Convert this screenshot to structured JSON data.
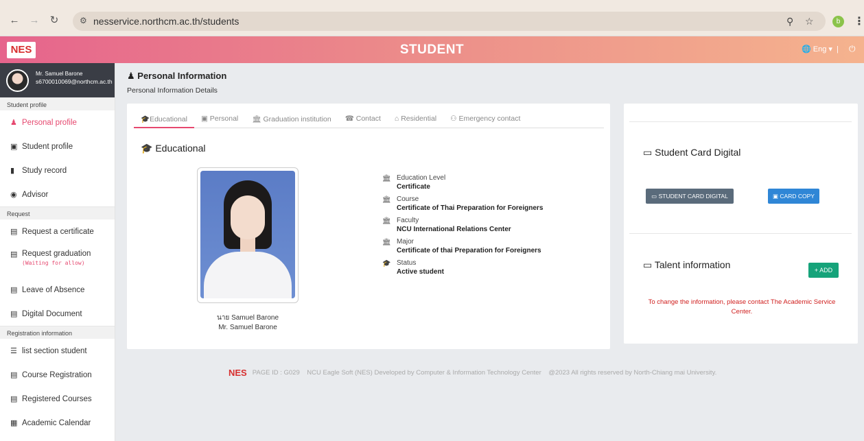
{
  "browser": {
    "url": "nesservice.northcm.ac.th/students",
    "profile_initial": "b"
  },
  "header": {
    "logo": "NES",
    "title": "STUDENT",
    "language": "Eng"
  },
  "user": {
    "name": "Mr. Samuel Barone",
    "email": "s6700010069@northcm.ac.th"
  },
  "sidebar": {
    "sections": [
      {
        "title": "Student profile",
        "items": [
          {
            "label": "Personal profile",
            "icon": "user-icon"
          },
          {
            "label": "Student profile",
            "icon": "id-card-icon"
          },
          {
            "label": "Study record",
            "icon": "bar-chart-icon"
          },
          {
            "label": "Advisor",
            "icon": "user-circle-icon"
          }
        ]
      },
      {
        "title": "Request",
        "items": [
          {
            "label": "Request a certificate",
            "icon": "file-icon"
          },
          {
            "label": "Request graduation",
            "note": "(Waiting for allow)",
            "icon": "file-icon"
          },
          {
            "label": "Leave of Absence",
            "icon": "file-icon"
          },
          {
            "label": "Digital Document",
            "icon": "file-icon"
          }
        ]
      },
      {
        "title": "Registration information",
        "items": [
          {
            "label": "list section student",
            "icon": "list-icon"
          },
          {
            "label": "Course Registration",
            "icon": "file-icon"
          },
          {
            "label": "Registered Courses",
            "icon": "file-icon"
          },
          {
            "label": "Academic Calendar",
            "icon": "calendar-icon"
          }
        ]
      }
    ]
  },
  "page": {
    "title": "Personal Information",
    "subtitle": "Personal Information Details"
  },
  "tabs": [
    "Educational",
    "Personal",
    "Graduation institution",
    "Contact",
    "Residential",
    "Emergency contact"
  ],
  "educational": {
    "title": "Educational",
    "name_th": "นาย Samuel Barone",
    "name_en": "Mr. Samuel Barone",
    "fields": [
      {
        "label": "Education Level",
        "value": "Certificate"
      },
      {
        "label": "Course",
        "value": "Certificate of Thai Preparation for Foreigners"
      },
      {
        "label": "Faculty",
        "value": "NCU International Relations Center"
      },
      {
        "label": "Major",
        "value": "Certificate of thai Preparation for Foreigners"
      },
      {
        "label": "Status",
        "value": "Active student"
      }
    ]
  },
  "side_panel": {
    "card_title": "Student Card Digital",
    "card_button": "STUDENT CARD DIGITAL",
    "copy_button": "CARD COPY",
    "talent_title": "Talent information",
    "add_button": "+ ADD",
    "notice": "To change the information, please contact The Academic Service Center."
  },
  "footer": {
    "logo": "NES",
    "text": "PAGE ID : G029    NCU Eagle Soft (NES) Developed by Computer & Information Technology Center    @2023 All rights reserved by North-Chiang mai University."
  }
}
